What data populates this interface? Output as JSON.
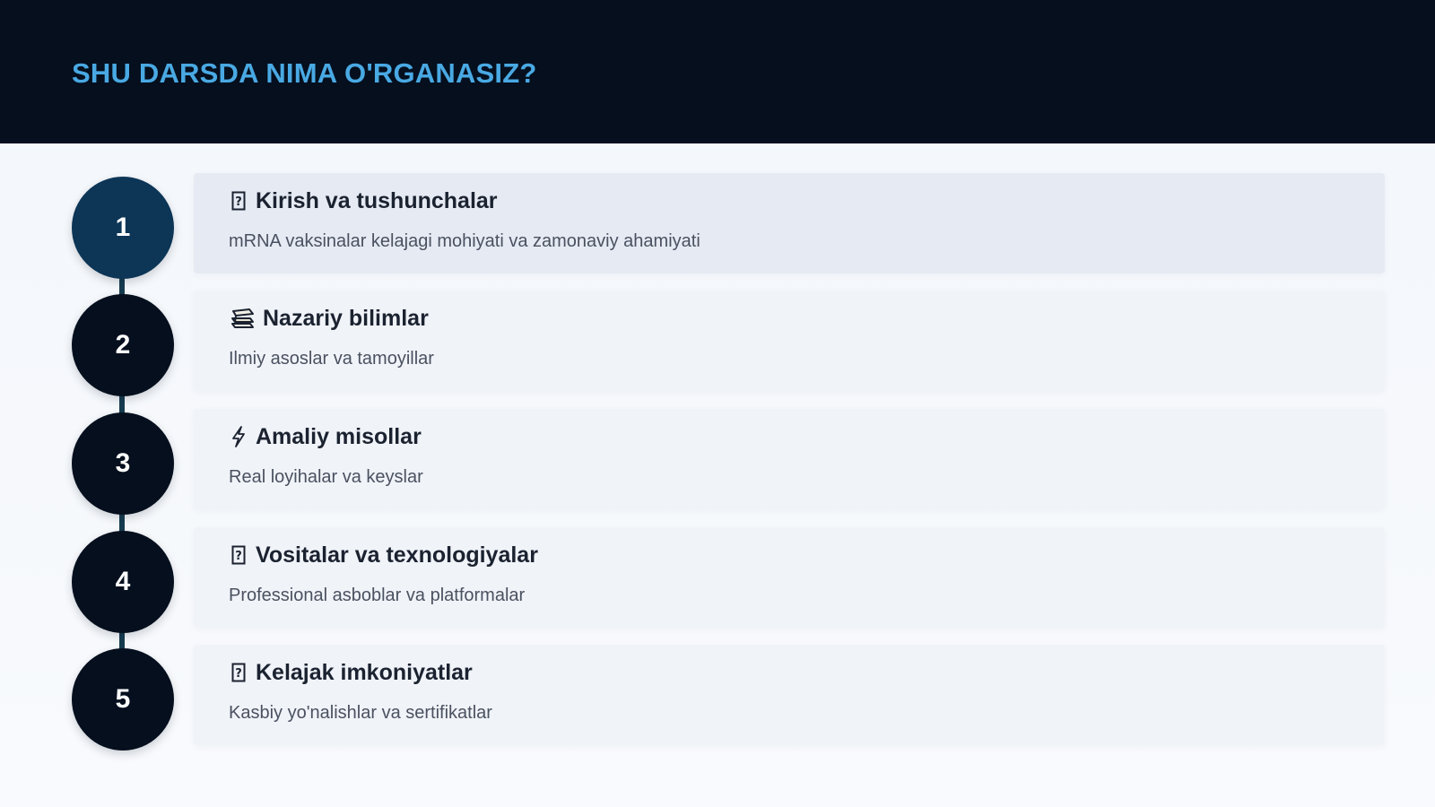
{
  "header": {
    "title": "SHU DARSDA NIMA O'RGANASIZ?"
  },
  "steps": [
    {
      "number": "1",
      "icon": "missing-glyph-icon",
      "title": "Kirish va tushunchalar",
      "description": "mRNA vaksinalar kelajagi mohiyati va zamonaviy ahamiyati",
      "active": true
    },
    {
      "number": "2",
      "icon": "books-icon",
      "title": "Nazariy bilimlar",
      "description": "Ilmiy asoslar va tamoyillar",
      "active": false
    },
    {
      "number": "3",
      "icon": "lightning-icon",
      "title": "Amaliy misollar",
      "description": "Real loyihalar va keyslar",
      "active": false
    },
    {
      "number": "4",
      "icon": "missing-glyph-icon",
      "title": "Vositalar va texnologiyalar",
      "description": "Professional asboblar va platformalar",
      "active": false
    },
    {
      "number": "5",
      "icon": "missing-glyph-icon",
      "title": "Kelajak imkoniyatlar",
      "description": "Kasbiy yo'nalishlar va sertifikatlar",
      "active": false
    }
  ],
  "colors": {
    "header_bg": "#050f1e",
    "title_accent": "#49a9e3",
    "circle_bg": "#050f1e",
    "circle_active_bg": "#0c3556",
    "card_bg": "#f0f3f8",
    "card_active_bg": "#e6eaf3"
  }
}
